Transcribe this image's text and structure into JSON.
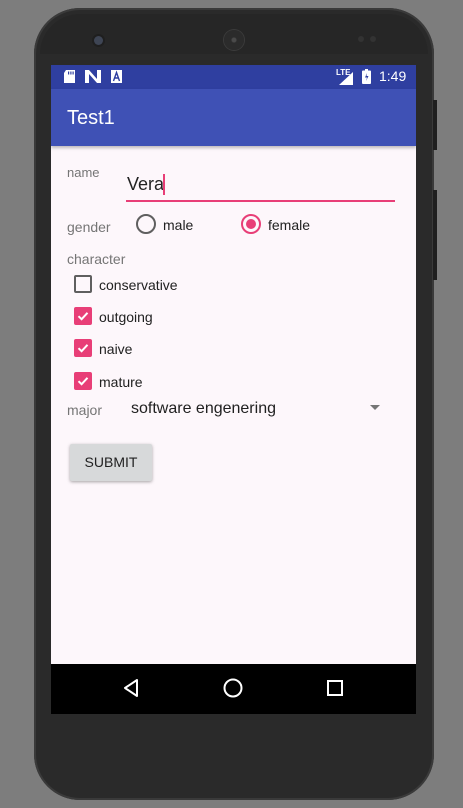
{
  "status_bar": {
    "time": "1:49",
    "network": "LTE",
    "icons": [
      "sd-card-icon",
      "n-notification-icon",
      "a-notification-icon",
      "signal-icon",
      "battery-icon"
    ]
  },
  "app_bar": {
    "title": "Test1",
    "color": "#3f51b5"
  },
  "form": {
    "name": {
      "label": "name",
      "value": "Vera"
    },
    "gender": {
      "label": "gender",
      "options": [
        {
          "label": "male",
          "selected": false
        },
        {
          "label": "female",
          "selected": true
        }
      ]
    },
    "character": {
      "label": "character",
      "options": [
        {
          "label": "conservative",
          "checked": false
        },
        {
          "label": "outgoing",
          "checked": true
        },
        {
          "label": "naive",
          "checked": true
        },
        {
          "label": "mature",
          "checked": true
        }
      ]
    },
    "major": {
      "label": "major",
      "selected": "software engenering"
    },
    "submit_label": "SUBMIT"
  },
  "nav_bar": {
    "buttons": [
      "back-icon",
      "home-icon",
      "recents-icon"
    ]
  },
  "colors": {
    "accent": "#e83e77",
    "primary_dark": "#2f3fa0"
  }
}
